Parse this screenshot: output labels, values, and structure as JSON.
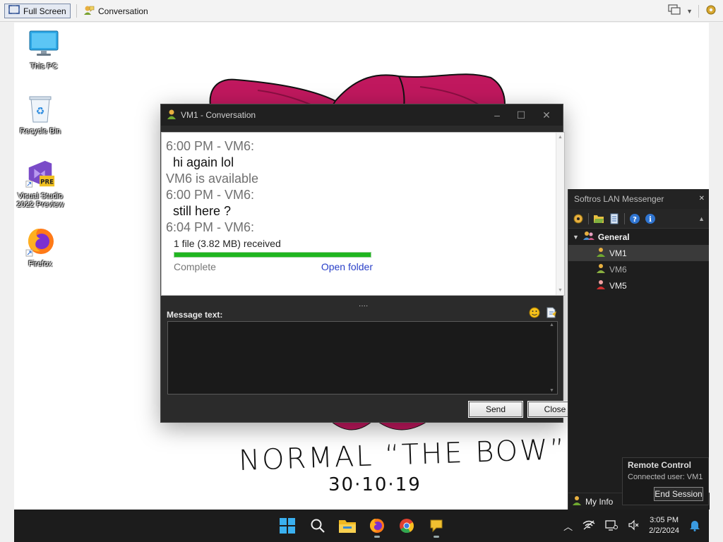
{
  "viewer": {
    "fullscreen_label": "Full Screen",
    "conversation_label": "Conversation"
  },
  "desktop": {
    "icons": [
      {
        "label": "This PC",
        "icon": "monitor-icon"
      },
      {
        "label": "Recycle Bin",
        "icon": "recycle-bin-icon"
      },
      {
        "label": "Visual Studio 2022 Preview",
        "icon": "visual-studio-icon"
      },
      {
        "label": "Firefox",
        "icon": "firefox-icon"
      }
    ],
    "drawing_caption": "NORMAL “THE BOW”",
    "drawing_date": "30·10·19"
  },
  "conversation": {
    "title": "VM1 - Conversation",
    "log": {
      "t1": "6:00 PM - VM6:",
      "m1": "hi again lol",
      "s1": "VM6 is available",
      "t2": "6:00 PM - VM6:",
      "m2": "still here ?",
      "t3": "6:04 PM - VM6:",
      "file_text": "1 file (3.82 MB) received",
      "file_progress": 1.0,
      "file_status": "Complete",
      "file_link": "Open folder"
    },
    "message_label": "Message text:",
    "message_value": "",
    "send_label": "Send",
    "close_label": "Close",
    "splitter": "····"
  },
  "softros": {
    "title": "Softros LAN Messenger",
    "group": "General",
    "users": [
      {
        "name": "VM1",
        "status": "online"
      },
      {
        "name": "VM6",
        "status": "available"
      },
      {
        "name": "VM5",
        "status": "busy"
      }
    ],
    "my_info": "My Info"
  },
  "remote": {
    "title": "Remote Control",
    "connected": "Connected user: VM1",
    "end_label": "End Session"
  },
  "taskbar": {
    "apps": [
      "windows-start-icon",
      "search-icon",
      "file-explorer-icon",
      "firefox-icon",
      "chrome-icon",
      "softros-icon"
    ],
    "time": "3:05 PM",
    "date": "2/2/2024"
  },
  "colors": {
    "bow": "#c0185e",
    "progress": "#1fb51f",
    "link": "#2a40c8"
  }
}
